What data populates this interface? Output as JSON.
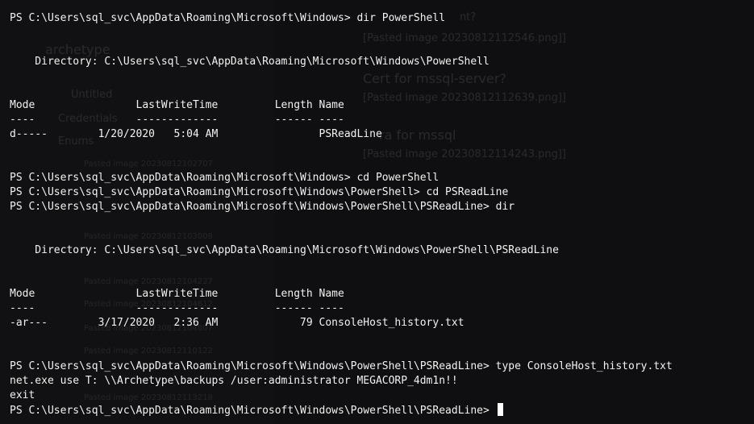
{
  "terminal": {
    "lines": [
      "PS C:\\Users\\sql_svc\\AppData\\Roaming\\Microsoft\\Windows> dir PowerShell",
      "",
      "",
      "    Directory: C:\\Users\\sql_svc\\AppData\\Roaming\\Microsoft\\Windows\\PowerShell",
      "",
      "",
      "Mode                LastWriteTime         Length Name",
      "----                -------------         ------ ----",
      "d-----        1/20/2020   5:04 AM                PSReadLine",
      "",
      "",
      "PS C:\\Users\\sql_svc\\AppData\\Roaming\\Microsoft\\Windows> cd PowerShell",
      "PS C:\\Users\\sql_svc\\AppData\\Roaming\\Microsoft\\Windows\\PowerShell> cd PSReadLine",
      "PS C:\\Users\\sql_svc\\AppData\\Roaming\\Microsoft\\Windows\\PowerShell\\PSReadLine> dir",
      "",
      "",
      "    Directory: C:\\Users\\sql_svc\\AppData\\Roaming\\Microsoft\\Windows\\PowerShell\\PSReadLine",
      "",
      "",
      "Mode                LastWriteTime         Length Name",
      "----                -------------         ------ ----",
      "-ar---        3/17/2020   2:36 AM             79 ConsoleHost_history.txt",
      "",
      "",
      "PS C:\\Users\\sql_svc\\AppData\\Roaming\\Microsoft\\Windows\\PowerShell\\PSReadLine> type ConsoleHost_history.txt",
      "net.exe use T: \\\\Archetype\\backups /user:administrator MEGACORP_4dm1n!!",
      "exit"
    ],
    "prompt": "PS C:\\Users\\sql_svc\\AppData\\Roaming\\Microsoft\\Windows\\PowerShell\\PSReadLine> "
  },
  "background_ghost": {
    "sidebar": [
      "archetype",
      "Untitled",
      "Credentials",
      "Enums"
    ],
    "pasted": [
      "Pasted image 20230812102707",
      "Pasted image 20230812103008",
      "Pasted image 20230812104227",
      "Pasted image 20230812104612",
      "Pasted image 20230812104807",
      "Pasted image 20230812110122",
      "Pasted image 20230812113218"
    ],
    "notes": [
      "nt?",
      "[Pasted image 20230812112546.png]]",
      "Cert for mssql-server?",
      "[Pasted image 20230812112639.png]]",
      "ra for mssql",
      "[Pasted image 20230812114243.png]]"
    ]
  },
  "colors": {
    "background": "#0f0f11",
    "foreground": "#f2f2f2",
    "cursor": "#ffffff"
  }
}
